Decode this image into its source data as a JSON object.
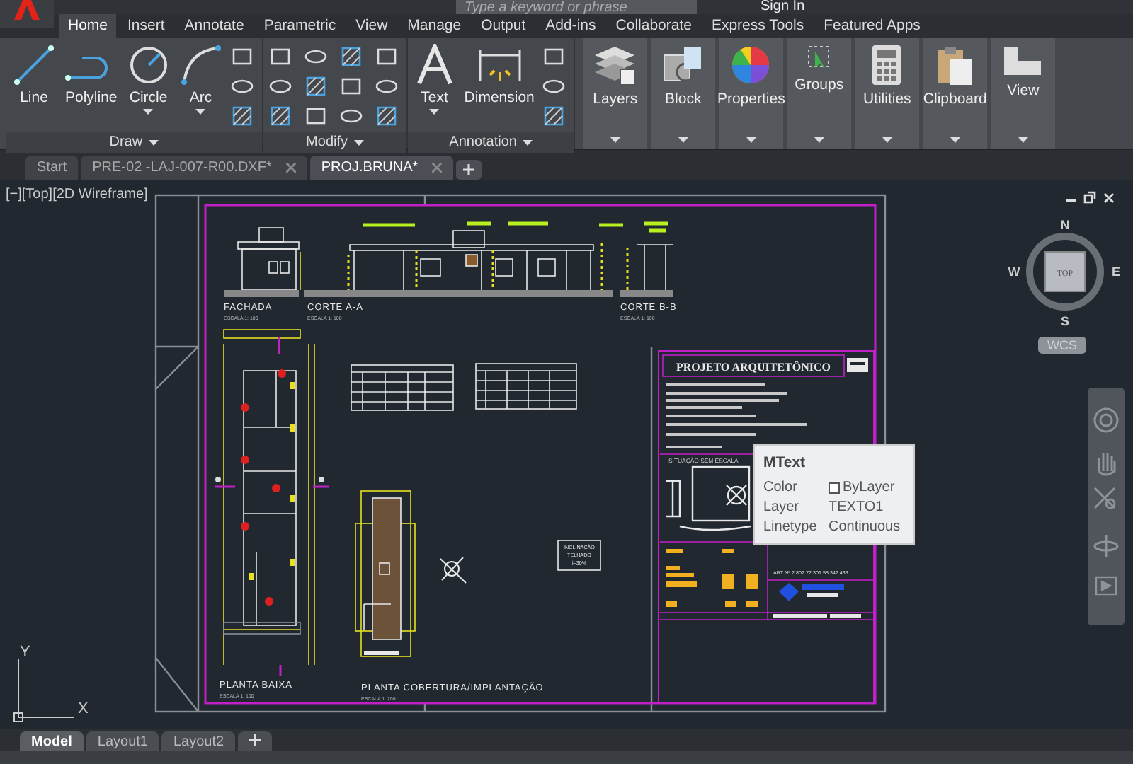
{
  "search": {
    "placeholder": "Type a keyword or phrase"
  },
  "sign_in": "Sign In",
  "ribbon_tabs": [
    {
      "label": "Home",
      "selected": true
    },
    {
      "label": "Insert",
      "selected": false
    },
    {
      "label": "Annotate",
      "selected": false
    },
    {
      "label": "Parametric",
      "selected": false
    },
    {
      "label": "View",
      "selected": false
    },
    {
      "label": "Manage",
      "selected": false
    },
    {
      "label": "Output",
      "selected": false
    },
    {
      "label": "Add-ins",
      "selected": false
    },
    {
      "label": "Collaborate",
      "selected": false
    },
    {
      "label": "Express Tools",
      "selected": false
    },
    {
      "label": "Featured Apps",
      "selected": false
    }
  ],
  "tool_panels": [
    {
      "title": "Draw",
      "kind": "draw",
      "tools": [
        {
          "label": "Line",
          "kind": "line",
          "dropdown": false
        },
        {
          "label": "Polyline",
          "kind": "polyline",
          "dropdown": false
        },
        {
          "label": "Circle",
          "kind": "circle",
          "dropdown": true
        },
        {
          "label": "Arc",
          "kind": "arc",
          "dropdown": true
        }
      ]
    },
    {
      "title": "Modify",
      "kind": "modify"
    },
    {
      "title": "Annotation",
      "kind": "annotation",
      "tools": [
        {
          "label": "Text",
          "kind": "text",
          "dropdown": true
        },
        {
          "label": "Dimension",
          "kind": "dimension",
          "dropdown": false
        }
      ]
    }
  ],
  "large_panels": [
    {
      "label": "Layers",
      "kind": "layers"
    },
    {
      "label": "Block",
      "kind": "block"
    },
    {
      "label": "Properties",
      "kind": "properties"
    },
    {
      "label": "Groups",
      "kind": "groups"
    },
    {
      "label": "Utilities",
      "kind": "utilities"
    },
    {
      "label": "Clipboard",
      "kind": "clipboard"
    },
    {
      "label": "View",
      "kind": "view"
    }
  ],
  "file_tabs": [
    {
      "label": "Start",
      "selected": false,
      "closable": false
    },
    {
      "label": "PRE-02 -LAJ-007-R00.DXF*",
      "selected": false,
      "closable": true
    },
    {
      "label": "PROJ.BRUNA*",
      "selected": true,
      "closable": true
    }
  ],
  "viewport": {
    "label": "[−][Top][2D Wireframe]",
    "views": [
      {
        "kind": "facade",
        "title": "FACHADA",
        "scale": "ESCALA 1: 100"
      },
      {
        "kind": "section_a",
        "title": "CORTE A-A",
        "scale": "ESCALA 1: 100"
      },
      {
        "kind": "section_b",
        "title": "CORTE B-B",
        "scale": "ESCALA 1: 100"
      },
      {
        "kind": "floor_plan",
        "title": "PLANTA BAIXA",
        "scale": "ESCALA 1: 100"
      },
      {
        "kind": "roof_plan",
        "title": "PLANTA COBERTURA/IMPLANTAÇÃO",
        "scale": "ESCALA 1: 200"
      }
    ],
    "note": [
      "INCLINAÇÃO",
      "TELHADO",
      "i=30%"
    ],
    "title_block": {
      "title": "PROJETO ARQUITETÔNICO",
      "situation": "SITUAÇÃO SEM ESCALA",
      "art": "ART Nº 2.802.72.301.55.342.433"
    }
  },
  "view_cube": {
    "north": "N",
    "east": "E",
    "south": "S",
    "west": "W",
    "face": "TOP",
    "ucs": "WCS"
  },
  "ucs_axes": {
    "x": "X",
    "y": "Y"
  },
  "tooltip": {
    "title": "MText",
    "rows": [
      {
        "label": "Color",
        "value": "ByLayer",
        "swatch": true
      },
      {
        "label": "Layer",
        "value": "TEXTO1",
        "swatch": false
      },
      {
        "label": "Linetype",
        "value": "Continuous",
        "swatch": false
      }
    ]
  },
  "layout_tabs": [
    {
      "label": "Model",
      "selected": true
    },
    {
      "label": "Layout1",
      "selected": false
    },
    {
      "label": "Layout2",
      "selected": false
    }
  ]
}
